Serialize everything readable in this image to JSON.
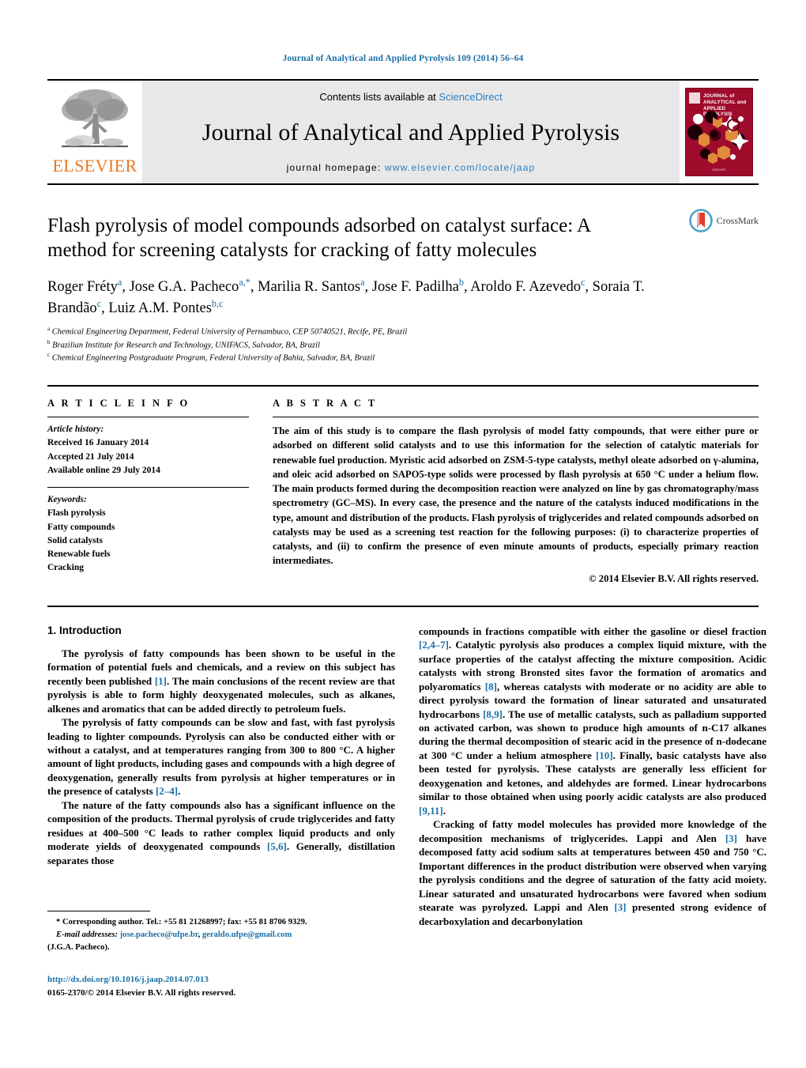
{
  "running_head": "Journal of Analytical and Applied Pyrolysis 109 (2014) 56–64",
  "masthead": {
    "publisher_name": "ELSEVIER",
    "contents_prefix": "Contents lists available at ",
    "contents_link": "ScienceDirect",
    "journal_title": "Journal of Analytical and Applied Pyrolysis",
    "homepage_prefix": "journal homepage: ",
    "homepage_url": "www.elsevier.com/locate/jaap",
    "cover_title": "JOURNAL of ANALYTICAL and APPLIED PYROLYSIS",
    "cover_publisher": "Elsevier"
  },
  "article": {
    "title": "Flash pyrolysis of model compounds adsorbed on catalyst surface: A method for screening catalysts for cracking of fatty molecules",
    "crossmark_label": "CrossMark",
    "authors_html": "Roger Fréty<sup>a</sup>, Jose G.A. Pacheco<sup>a,*</sup>, Marilia R. Santos<sup>a</sup>, Jose F. Padilha<sup>b</sup>, Aroldo F. Azevedo<sup>c</sup>, Soraia T. Brandão<sup>c</sup>, Luiz A.M. Pontes<sup>b,c</sup>",
    "affiliations": [
      {
        "marker": "a",
        "text": "Chemical Engineering Department, Federal University of Pernambuco, CEP 50740521, Recife, PE, Brazil"
      },
      {
        "marker": "b",
        "text": "Brazilian Institute for Research and Technology, UNIFACS, Salvador, BA, Brazil"
      },
      {
        "marker": "c",
        "text": "Chemical Engineering Postgraduate Program, Federal University of Bahia, Salvador, BA, Brazil"
      }
    ]
  },
  "article_info": {
    "heading": "A R T I C L E   I N F O",
    "history_label": "Article history:",
    "history": [
      "Received 16 January 2014",
      "Accepted 21 July 2014",
      "Available online 29 July 2014"
    ],
    "keywords_label": "Keywords:",
    "keywords": [
      "Flash pyrolysis",
      "Fatty compounds",
      "Solid catalysts",
      "Renewable fuels",
      "Cracking"
    ]
  },
  "abstract": {
    "heading": "A B S T R A C T",
    "text": "The aim of this study is to compare the flash pyrolysis of model fatty compounds, that were either pure or adsorbed on different solid catalysts and to use this information for the selection of catalytic materials for renewable fuel production. Myristic acid adsorbed on ZSM-5-type catalysts, methyl oleate adsorbed on γ-alumina, and oleic acid adsorbed on SAPO5-type solids were processed by flash pyrolysis at 650 °C under a helium flow. The main products formed during the decomposition reaction were analyzed on line by gas chromatography/mass spectrometry (GC–MS). In every case, the presence and the nature of the catalysts induced modifications in the type, amount and distribution of the products. Flash pyrolysis of triglycerides and related compounds adsorbed on catalysts may be used as a screening test reaction for the following purposes: (i) to characterize properties of catalysts, and (ii) to confirm the presence of even minute amounts of products, especially primary reaction intermediates.",
    "copyright": "© 2014 Elsevier B.V. All rights reserved."
  },
  "introduction": {
    "heading": "1.  Introduction",
    "left_paragraphs": [
      "The pyrolysis of fatty compounds has been shown to be useful in the formation of potential fuels and chemicals, and a review on this subject has recently been published [1]. The main conclusions of the recent review are that pyrolysis is able to form highly deoxygenated molecules, such as alkanes, alkenes and aromatics that can be added directly to petroleum fuels.",
      "The pyrolysis of fatty compounds can be slow and fast, with fast pyrolysis leading to lighter compounds. Pyrolysis can also be conducted either with or without a catalyst, and at temperatures ranging from 300 to 800 °C. A higher amount of light products, including gases and compounds with a high degree of deoxygenation, generally results from pyrolysis at higher temperatures or in the presence of catalysts [2–4].",
      "The nature of the fatty compounds also has a significant influence on the composition of the products. Thermal pyrolysis of crude triglycerides and fatty residues at 400–500 °C leads to rather complex liquid products and only moderate yields of deoxygenated compounds [5,6]. Generally, distillation separates those"
    ],
    "right_paragraphs": [
      "compounds in fractions compatible with either the gasoline or diesel fraction [2,4–7]. Catalytic pyrolysis also produces a complex liquid mixture, with the surface properties of the catalyst affecting the mixture composition. Acidic catalysts with strong Bronsted sites favor the formation of aromatics and polyaromatics [8], whereas catalysts with moderate or no acidity are able to direct pyrolysis toward the formation of linear saturated and unsaturated hydrocarbons [8,9]. The use of metallic catalysts, such as palladium supported on activated carbon, was shown to produce high amounts of n-C17 alkanes during the thermal decomposition of stearic acid in the presence of n-dodecane at 300 °C under a helium atmosphere [10]. Finally, basic catalysts have also been tested for pyrolysis. These catalysts are generally less efficient for deoxygenation and ketones, and aldehydes are formed. Linear hydrocarbons similar to those obtained when using poorly acidic catalysts are also produced [9,11].",
      "Cracking of fatty model molecules has provided more knowledge of the decomposition mechanisms of triglycerides. Lappi and Alen [3] have decomposed fatty acid sodium salts at temperatures between 450 and 750 °C. Important differences in the product distribution were observed when varying the pyrolysis conditions and the degree of saturation of the fatty acid moiety. Linear saturated and unsaturated hydrocarbons were favored when sodium stearate was pyrolyzed. Lappi and Alen [3] presented strong evidence of decarboxylation and decarbonylation"
    ]
  },
  "footnote": {
    "corresponding": "* Corresponding author. Tel.: +55 81 21268997; fax: +55 81 8706 9329.",
    "email_label": "E-mail addresses:",
    "email1": "jose.pacheco@ufpe.br",
    "email_sep": ", ",
    "email2": "geraldo.ufpe@gmail.com",
    "email_attrib": "(J.G.A. Pacheco).",
    "doi": "http://dx.doi.org/10.1016/j.jaap.2014.07.013",
    "issn": "0165-2370/© 2014 Elsevier B.V. All rights reserved."
  },
  "colors": {
    "link_blue": "#1A6FA8",
    "sciencedirect_blue": "#2B7EC1",
    "elsevier_orange": "#E87722",
    "cover_red": "#9E0B2B",
    "panel_gray": "#e8e8e8"
  }
}
